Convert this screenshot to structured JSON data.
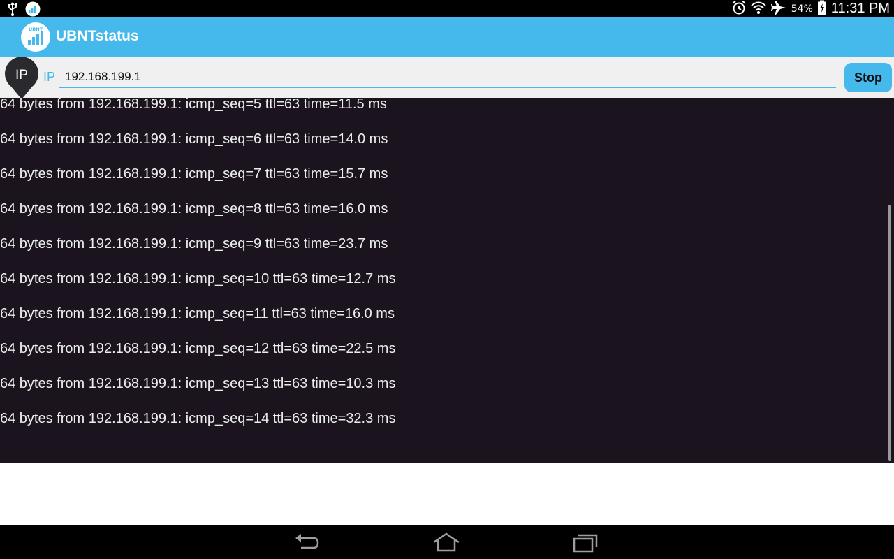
{
  "status_bar": {
    "icons_left": [
      "usb-icon",
      "ubnt-notification-icon"
    ],
    "icons_right": [
      "alarm-icon",
      "wifi-icon",
      "airplane-mode-icon"
    ],
    "battery_percent": "54%",
    "time": "11:31 PM"
  },
  "app": {
    "title": "UBNTstatus",
    "logo_text": "UBNT",
    "accent_color": "#45b9ec"
  },
  "ip_bar": {
    "badge": "IP",
    "label": "IP",
    "value": "192.168.199.1",
    "stop_label": "Stop"
  },
  "log": {
    "lines": [
      "64 bytes from 192.168.199.1: icmp_seq=5 ttl=63 time=11.5 ms",
      "64 bytes from 192.168.199.1: icmp_seq=6 ttl=63 time=14.0 ms",
      "64 bytes from 192.168.199.1: icmp_seq=7 ttl=63 time=15.7 ms",
      "64 bytes from 192.168.199.1: icmp_seq=8 ttl=63 time=16.0 ms",
      "64 bytes from 192.168.199.1: icmp_seq=9 ttl=63 time=23.7 ms",
      "64 bytes from 192.168.199.1: icmp_seq=10 ttl=63 time=12.7 ms",
      "64 bytes from 192.168.199.1: icmp_seq=11 ttl=63 time=16.0 ms",
      "64 bytes from 192.168.199.1: icmp_seq=12 ttl=63 time=22.5 ms",
      "64 bytes from 192.168.199.1: icmp_seq=13 ttl=63 time=10.3 ms",
      "64 bytes from 192.168.199.1: icmp_seq=14 ttl=63 time=32.3 ms"
    ]
  },
  "nav_bar": {
    "buttons": [
      "back-icon",
      "home-icon",
      "recent-apps-icon"
    ]
  }
}
